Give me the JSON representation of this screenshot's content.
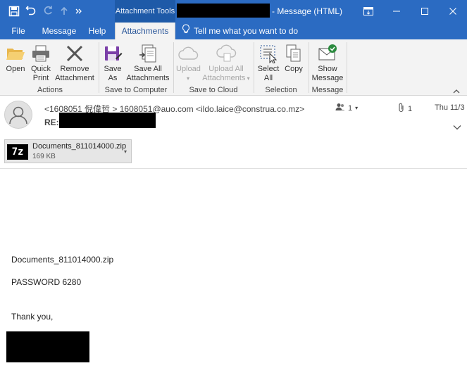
{
  "window": {
    "contextual_tab": "Attachment Tools",
    "title_suffix": "- Message (HTML)"
  },
  "tabs": [
    {
      "label": "File"
    },
    {
      "label": "Message"
    },
    {
      "label": "Help"
    },
    {
      "label": "Attachments"
    }
  ],
  "tell_me": "Tell me what you want to do",
  "ribbon": {
    "actions": {
      "group_label": "Actions",
      "open": "Open",
      "quick_print_1": "Quick",
      "quick_print_2": "Print",
      "remove_1": "Remove",
      "remove_2": "Attachment"
    },
    "save": {
      "group_label": "Save to Computer",
      "save_as_1": "Save",
      "save_as_2": "As",
      "save_all_1": "Save All",
      "save_all_2": "Attachments"
    },
    "cloud": {
      "group_label": "Save to Cloud",
      "upload_1": "Upload",
      "upload_all_1": "Upload All",
      "upload_all_2": "Attachments"
    },
    "selection": {
      "group_label": "Selection",
      "select_all_1": "Select",
      "select_all_2": "All",
      "copy": "Copy"
    },
    "message": {
      "group_label": "Message",
      "show_1": "Show",
      "show_2": "Message"
    }
  },
  "header": {
    "from": "<1608051 倪偉哲 > 1608051@auo.com <ildo.laice@construa.co.mz>",
    "subject_prefix": "RE:",
    "people_count": "1",
    "attachment_count": "1",
    "date": "Thu 11/3"
  },
  "attachment": {
    "icon_text": "7z",
    "name": "Documents_811014000.zip",
    "size": "169 KB"
  },
  "body": {
    "line1": "Documents_811014000.zip",
    "line2": "PASSWORD 6280",
    "line3": "Thank you,"
  },
  "colors": {
    "title_bar": "#2b6bc2",
    "ribbon": "#f3f3f3",
    "accent": "#2b579a"
  }
}
